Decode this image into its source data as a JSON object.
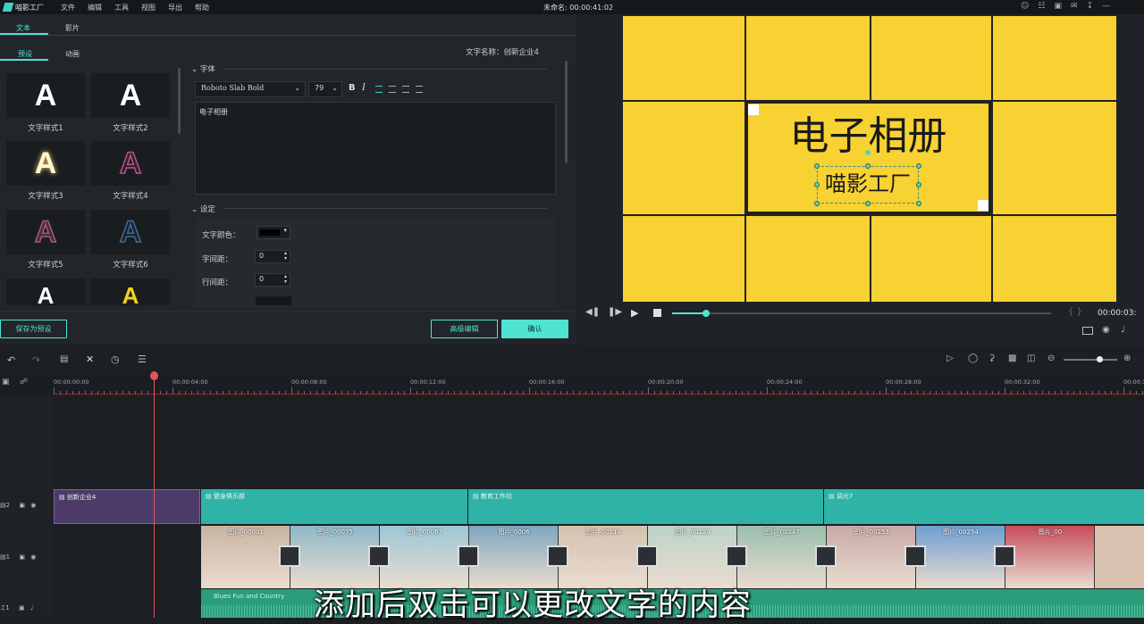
{
  "app": {
    "logo_text": "喵影工厂",
    "menu": [
      "文件",
      "编辑",
      "工具",
      "视图",
      "导出",
      "帮助"
    ],
    "project_title": "未命名: 00:00:41:02",
    "window_icons": [
      "user-icon",
      "cart-icon",
      "save-icon",
      "mail-icon",
      "download-icon",
      "minimize-icon",
      "maximize-icon",
      "close-icon"
    ]
  },
  "left_panel": {
    "top_tabs": [
      "文本",
      "影片"
    ],
    "sub_tabs": [
      "预设",
      "动画"
    ],
    "text_name_label": "文字名称：创新企业4",
    "presets": [
      {
        "label": "文字样式1",
        "glyph": "A",
        "color": "#ffffff"
      },
      {
        "label": "文字样式2",
        "glyph": "A",
        "color": "#ffffff"
      },
      {
        "label": "文字样式3",
        "glyph": "A",
        "color": "#fff6d0"
      },
      {
        "label": "文字样式4",
        "glyph": "A",
        "color": "#7a3a6a"
      },
      {
        "label": "文字样式5",
        "glyph": "A",
        "color": "#8b4d6a"
      },
      {
        "label": "文字样式6",
        "glyph": "A",
        "color": "#2e4e6a"
      },
      {
        "label": "",
        "glyph": "A",
        "color": "#ffffff"
      },
      {
        "label": "",
        "glyph": "A",
        "color": "#f2d21c"
      }
    ],
    "font_section": "字体",
    "font_family": "Roboto Slab Bold",
    "font_size": "79",
    "text_content": "电子相册",
    "settings_section": "设定",
    "text_color_label": "文字颜色：",
    "letter_spacing_label": "字间距：",
    "letter_spacing_value": "0",
    "line_spacing_label": "行间距：",
    "line_spacing_value": "0",
    "save_preset_label": "保存为预设",
    "advanced_edit_label": "高级编辑",
    "confirm_label": "确认"
  },
  "preview": {
    "title_text": "电子相册",
    "subtitle_text": "喵影工厂",
    "timecode": "00:00:03:",
    "playhead_progress": 0.09,
    "accent": "#4fe3d1",
    "canvas_bg": "#f8d132"
  },
  "timeline": {
    "ruler_labels": [
      "00:00:00:00",
      "00:00:04:00",
      "00:00:08:00",
      "00:00:12:00",
      "00:00:16:00",
      "00:00:20:00",
      "00:00:24:00",
      "00:00:28:00",
      "00:00:32:00",
      "00:00:3"
    ],
    "tracks": {
      "text_track_number": "2",
      "video_track_number": "1",
      "audio_track_number": "1"
    },
    "text_clips": [
      "创新企业4",
      "健身俱乐部",
      "教育工作坊",
      "调光7"
    ],
    "video_clips": [
      "图片_00001",
      "图片_00075",
      "图片_00067",
      "图片_0006",
      "图片_00114",
      "图片_00124",
      "图片_00247",
      "图片_00253",
      "图片_00254",
      "图片_00"
    ],
    "audio_clip": "Blues Fun and Country"
  },
  "subtitle_caption": "添加后双击可以更改文字的内容"
}
